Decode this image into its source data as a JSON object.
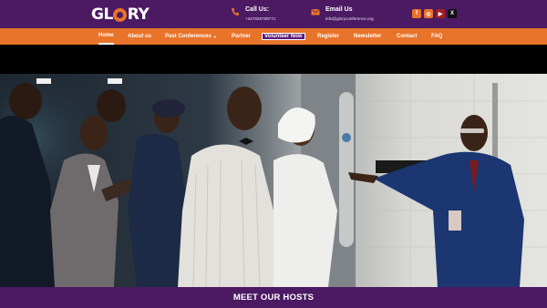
{
  "brand": {
    "logo_text": "GLORY",
    "accent": "#e8732a",
    "primary": "#4b1a63"
  },
  "header": {
    "call": {
      "label": "Call Us:",
      "value": "+447828759771",
      "icon": "phone-icon"
    },
    "email": {
      "label": "Email Us",
      "value": "info@gloryconference.org",
      "icon": "mail-icon"
    },
    "socials": [
      {
        "name": "facebook-icon",
        "glyph": "f"
      },
      {
        "name": "instagram-icon",
        "glyph": "◎"
      },
      {
        "name": "youtube-icon",
        "glyph": "▶"
      },
      {
        "name": "x-icon",
        "glyph": "X"
      }
    ]
  },
  "nav": {
    "home": "Home",
    "about": "About us",
    "past": "Past Conferences",
    "partner": "Partner",
    "volunteer": "Volunteer Now",
    "register": "Register",
    "newsletter": "Newsletter",
    "contact": "Contact",
    "faq": "FAQ"
  },
  "hero": {
    "image": "hosts-photo"
  },
  "section": {
    "title": "MEET OUR HOSTS"
  }
}
